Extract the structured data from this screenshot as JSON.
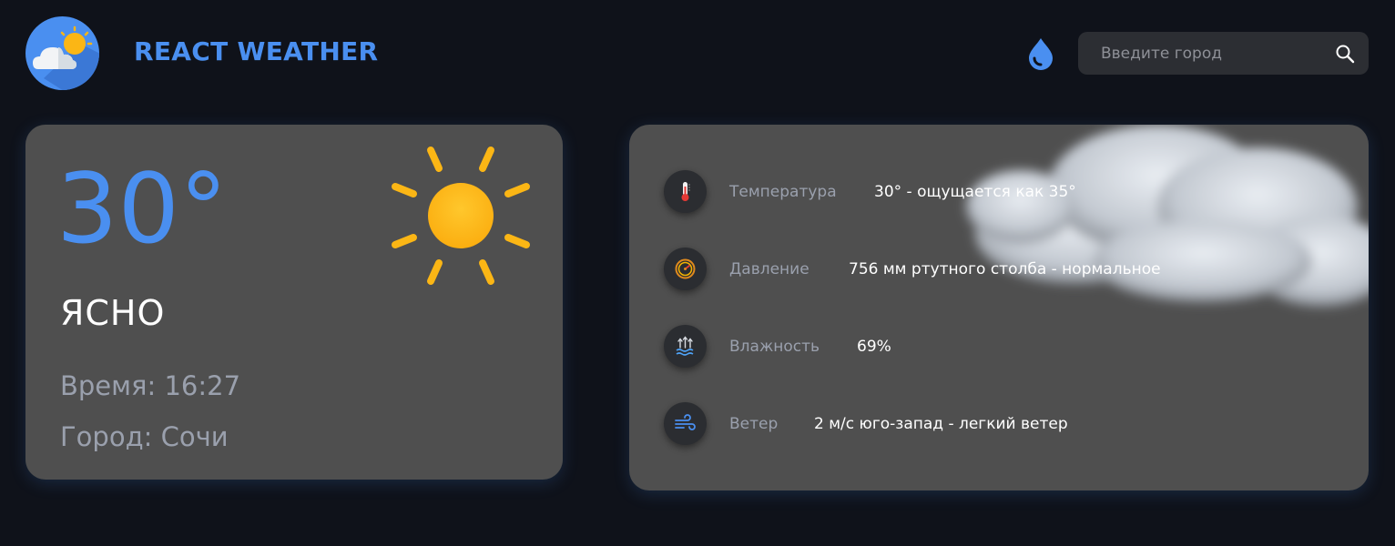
{
  "header": {
    "brand": "REACT WEATHER",
    "search_placeholder": "Введите город"
  },
  "today": {
    "temperature": "30°",
    "condition": "ЯСНО",
    "time_line": "Время: 16:27",
    "city_line": "Город: Сочи"
  },
  "details": [
    {
      "icon": "thermometer-icon",
      "label": "Температура",
      "value": "30° - ощущается как 35°"
    },
    {
      "icon": "pressure-gauge-icon",
      "label": "Давление",
      "value": "756 мм ртутного столба - нормальное"
    },
    {
      "icon": "humidity-icon",
      "label": "Влажность",
      "value": "69%"
    },
    {
      "icon": "wind-icon",
      "label": "Ветер",
      "value": "2 м/с юго-запад - легкий ветер"
    }
  ],
  "colors": {
    "accent": "#4a8ff0",
    "background": "#0f121a",
    "card": "#4f4f4f",
    "sun": "#fbb615"
  }
}
